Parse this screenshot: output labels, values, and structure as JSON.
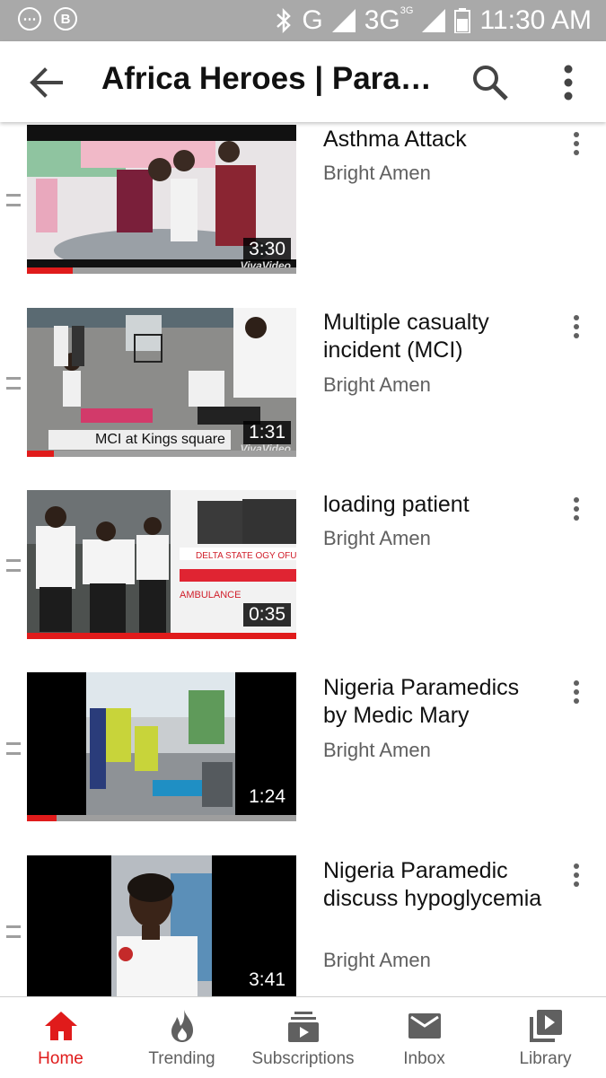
{
  "status_bar": {
    "network": "G",
    "network_secondary": "3G",
    "network_secondary_sup": "3G",
    "time": "11:30 AM",
    "icons": [
      "notification-icon",
      "b-app-icon",
      "bluetooth-icon",
      "signal-icon",
      "battery-icon"
    ]
  },
  "app_bar": {
    "title": "Africa Heroes | Paramedics",
    "icons": [
      "back-arrow-icon",
      "search-icon",
      "more-vert-icon"
    ]
  },
  "videos": [
    {
      "title": "Asthma Attack",
      "channel": "Bright Amen",
      "duration": "3:30",
      "watched_fraction": 0.17,
      "watermark": "VivaVideo"
    },
    {
      "title": "Multiple casualty incident (MCI)",
      "channel": "Bright Amen",
      "duration": "1:31",
      "watched_fraction": 0.1,
      "caption": "MCI at Kings square",
      "watermark": "VivaVideo"
    },
    {
      "title": "loading patient",
      "channel": "Bright Amen",
      "duration": "0:35",
      "watched_fraction": 1.0,
      "ambulance_text": "DELTA STATE OGY OFUOMA",
      "ambulance_label": "AMBULANCE"
    },
    {
      "title": "Nigeria Paramedics by Medic Mary",
      "channel": "Bright Amen",
      "duration": "1:24",
      "watched_fraction": 0.11
    },
    {
      "title": "Nigeria Paramedic discuss hypoglycemia",
      "channel": "Bright Amen",
      "duration": "3:41",
      "watched_fraction": 0.0
    }
  ],
  "bottom_nav": [
    {
      "label": "Home",
      "icon": "home-icon",
      "active": true
    },
    {
      "label": "Trending",
      "icon": "flame-icon",
      "active": false
    },
    {
      "label": "Subscriptions",
      "icon": "subscriptions-icon",
      "active": false
    },
    {
      "label": "Inbox",
      "icon": "mail-icon",
      "active": false
    },
    {
      "label": "Library",
      "icon": "library-icon",
      "active": false
    }
  ],
  "colors": {
    "accent": "#e01b1b",
    "status_bar": "#a9a9a9",
    "secondary_text": "#606060"
  }
}
